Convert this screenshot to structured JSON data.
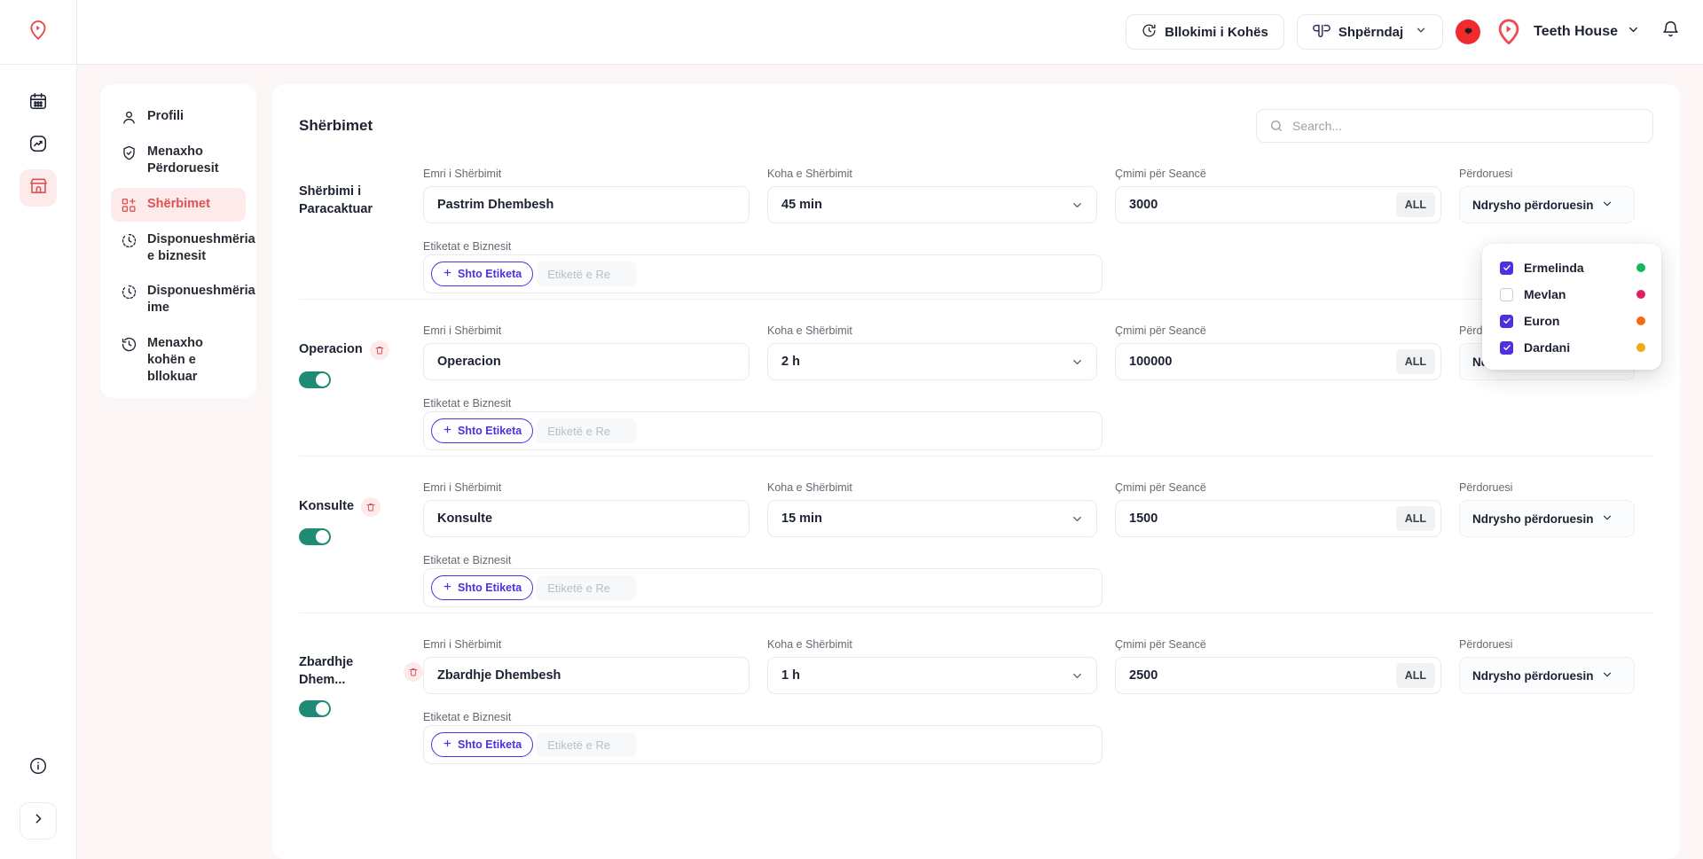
{
  "header": {
    "logo_icon": "location-pin-logo",
    "time_block_button": {
      "label": "Bllokimi i Kohës",
      "icon": "clock-icon"
    },
    "share_button": {
      "label": "Shpërndaj",
      "icon": "link-icon",
      "chevron": "chevron-down-icon"
    },
    "language_flag": {
      "name": "albania-flag-badge",
      "color": "#ef2b2d"
    },
    "brand": {
      "name": "Teeth House",
      "avatar_icon": "brand-logo-avatar",
      "chevron": "chevron-down-icon"
    },
    "notifications_icon": "bell-icon"
  },
  "rail": {
    "items": [
      {
        "icon": "calendar-icon",
        "active": false
      },
      {
        "icon": "analytics-icon",
        "active": false
      },
      {
        "icon": "storefront-icon",
        "active": true
      }
    ],
    "info_icon": "info-circle-icon",
    "expand_icon": "chevron-right-icon"
  },
  "nav": {
    "items": [
      {
        "label": "Profili",
        "icon": "user-icon",
        "active": false
      },
      {
        "label": "Menaxho Përdoruesit",
        "icon": "shield-check-icon",
        "active": false
      },
      {
        "label": "Shërbimet",
        "icon": "services-grid-icon",
        "active": true
      },
      {
        "label": "Disponueshmëria e biznesit",
        "icon": "clock-dashed-icon",
        "active": false
      },
      {
        "label": "Disponueshmëria ime",
        "icon": "clock-dashed-icon",
        "active": false
      },
      {
        "label": "Menaxho kohën e bllokuar",
        "icon": "clock-history-icon",
        "active": false
      }
    ]
  },
  "main": {
    "title": "Shërbimet",
    "search": {
      "placeholder": "Search...",
      "value": "",
      "icon": "search-icon"
    },
    "labels": {
      "name": "Emri i Shërbimit",
      "time": "Koha e Shërbimit",
      "price": "Çmimi për Seancë",
      "user": "Përdoruesi",
      "tags": "Etiketat e Biznesit"
    },
    "add_tag_label": "Shto Etiketa",
    "tag_placeholder": "Etiketë e Re",
    "currency_badge": "ALL",
    "user_select_label": "Ndrysho përdoruesin",
    "rows": [
      {
        "title": "Shërbimi i Paracaktuar",
        "name": "Pastrim Dhembesh",
        "time": "45 min",
        "price": "3000",
        "deletable": false,
        "toggle": null
      },
      {
        "title": "Operacion",
        "name": "Operacion",
        "time": "2 h",
        "price": "100000",
        "deletable": true,
        "toggle": true
      },
      {
        "title": "Konsulte",
        "name": "Konsulte",
        "time": "15 min",
        "price": "1500",
        "deletable": true,
        "toggle": true
      },
      {
        "title": "Zbardhje Dhem...",
        "name": "Zbardhje Dhembesh",
        "time": "1 h",
        "price": "2500",
        "deletable": true,
        "toggle": true
      }
    ]
  },
  "user_dropdown": {
    "options": [
      {
        "name": "Ermelinda",
        "checked": true,
        "color": "#12b75e"
      },
      {
        "name": "Mevlan",
        "checked": false,
        "color": "#e21d66"
      },
      {
        "name": "Euron",
        "checked": true,
        "color": "#f9690e"
      },
      {
        "name": "Dardani",
        "checked": true,
        "color": "#edab14"
      }
    ]
  },
  "colors": {
    "accent_red": "#e05252",
    "accent_purple": "#4f2fe0",
    "toggle_on": "#1f8a75",
    "canvas": "#fcf6f6"
  }
}
